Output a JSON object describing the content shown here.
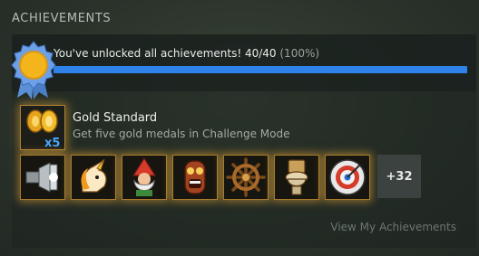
{
  "section": {
    "title": "ACHIEVEMENTS"
  },
  "progress": {
    "message": "You've unlocked all achievements! 40/40",
    "percent_text": "(100%)",
    "fraction": 1.0
  },
  "featured": {
    "name": "Gold Standard",
    "description": "Get five gold medals in Challenge Mode",
    "icon": "gold-medals-x5-icon",
    "icon_label": "x5"
  },
  "badges": [
    {
      "icon": "headlight-icon"
    },
    {
      "icon": "unicorn-icon"
    },
    {
      "icon": "gnome-icon"
    },
    {
      "icon": "tiki-mask-icon"
    },
    {
      "icon": "ship-wheel-icon"
    },
    {
      "icon": "toilet-icon"
    },
    {
      "icon": "dartboard-icon"
    }
  ],
  "more_count": "+32",
  "view_link": "View My Achievements",
  "colors": {
    "accent": "#2e82ea",
    "glow": "#e6a537"
  }
}
